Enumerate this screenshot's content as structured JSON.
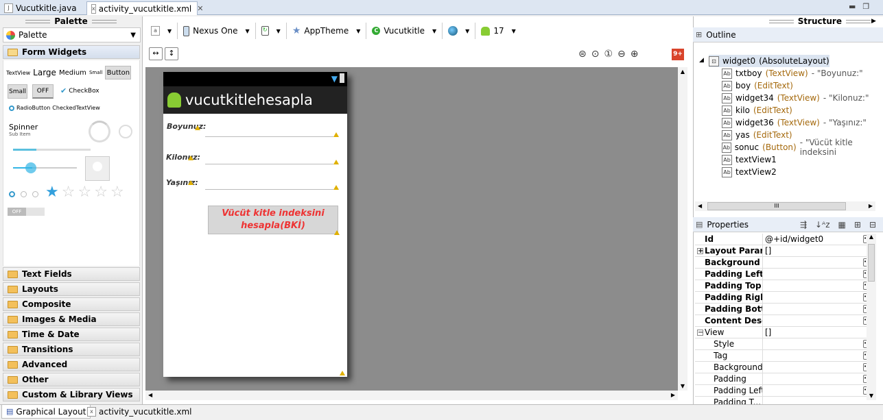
{
  "tabs": [
    {
      "label": "Vucutkitle.java",
      "icon": "java-file-icon"
    },
    {
      "label": "activity_vucutkitle.xml",
      "icon": "xml-file-icon"
    }
  ],
  "palette": {
    "header": "Palette",
    "selector_label": "Palette",
    "section": "Form Widgets",
    "widgets": {
      "textview": "TextView",
      "large": "Large",
      "medium": "Medium",
      "small": "Small",
      "button": "Button",
      "small_btn": "Small",
      "off_toggle": "OFF",
      "checkbox": "CheckBox",
      "radiobutton": "RadioButton",
      "checkedtextview": "CheckedTextView",
      "spinner": "Spinner",
      "spinner_sub": "Sub Item",
      "switch_off": "OFF"
    },
    "categories": [
      "Text Fields",
      "Layouts",
      "Composite",
      "Images & Media",
      "Time & Date",
      "Transitions",
      "Advanced",
      "Other",
      "Custom & Library Views"
    ]
  },
  "toolbar": {
    "device": "Nexus One",
    "theme": "AppTheme",
    "activity": "Vucutkitle",
    "api": "17",
    "badge": "9+"
  },
  "device_screen": {
    "app_title": "vucutkitlehesapla",
    "label_height": "Boyunuz:",
    "label_weight": "Kilonuz:",
    "label_age": "Yaşınız:",
    "button_line1": "Vücüt kitle indeksini",
    "button_line2": "hesapla(BKİ)"
  },
  "structure": {
    "header": "Structure",
    "outline_title": "Outline",
    "root": {
      "name": "widget0",
      "type": "(AbsoluteLayout)"
    },
    "nodes": [
      {
        "name": "txtboy",
        "type": "(TextView)",
        "text": "- \"Boyunuz:\"",
        "icon": "textview-icon"
      },
      {
        "name": "boy",
        "type": "(EditText)",
        "text": "",
        "icon": "edittext-icon"
      },
      {
        "name": "widget34",
        "type": "(TextView)",
        "text": "- \"Kilonuz:\"",
        "icon": "textview-icon"
      },
      {
        "name": "kilo",
        "type": "(EditText)",
        "text": "",
        "icon": "edittext-icon"
      },
      {
        "name": "widget36",
        "type": "(TextView)",
        "text": "- \"Yaşınız:\"",
        "icon": "textview-icon"
      },
      {
        "name": "yas",
        "type": "(EditText)",
        "text": "",
        "icon": "edittext-icon"
      },
      {
        "name": "sonuc",
        "type": "(Button)",
        "text": "- \"Vücüt kitle indeksini",
        "icon": "button-icon"
      },
      {
        "name": "textView1",
        "type": "",
        "text": "",
        "icon": "textview-icon"
      },
      {
        "name": "textView2",
        "type": "",
        "text": "",
        "icon": "textview-icon"
      }
    ],
    "scroll_grip": "III"
  },
  "properties": {
    "title": "Properties",
    "rows": [
      {
        "name": "Id",
        "value": "@+id/widget0",
        "bold": true,
        "dots": true
      },
      {
        "name": "Layout Param...",
        "value": "[]",
        "bold": true,
        "dots": false,
        "expand": "+"
      },
      {
        "name": "Background",
        "value": "",
        "bold": true,
        "dots": true
      },
      {
        "name": "Padding Left",
        "value": "",
        "bold": true,
        "dots": true
      },
      {
        "name": "Padding Top",
        "value": "",
        "bold": true,
        "dots": true
      },
      {
        "name": "Padding Right",
        "value": "",
        "bold": true,
        "dots": true
      },
      {
        "name": "Padding Bott...",
        "value": "",
        "bold": true,
        "dots": true
      },
      {
        "name": "Content Desc...",
        "value": "",
        "bold": true,
        "dots": true
      },
      {
        "name": "View",
        "value": "[]",
        "bold": false,
        "dots": false,
        "expand": "−"
      },
      {
        "name": "Style",
        "value": "",
        "bold": false,
        "dots": true,
        "indent": true
      },
      {
        "name": "Tag",
        "value": "",
        "bold": false,
        "dots": true,
        "indent": true
      },
      {
        "name": "Background",
        "value": "",
        "bold": false,
        "dots": true,
        "indent": true
      },
      {
        "name": "Padding",
        "value": "",
        "bold": false,
        "dots": true,
        "indent": true
      },
      {
        "name": "Padding Left",
        "value": "",
        "bold": false,
        "dots": true,
        "indent": true
      },
      {
        "name": "Padding T...",
        "value": "",
        "bold": false,
        "dots": false,
        "indent": true
      }
    ]
  },
  "bottom_tabs": [
    "Graphical Layout",
    "activity_vucutkitle.xml"
  ]
}
